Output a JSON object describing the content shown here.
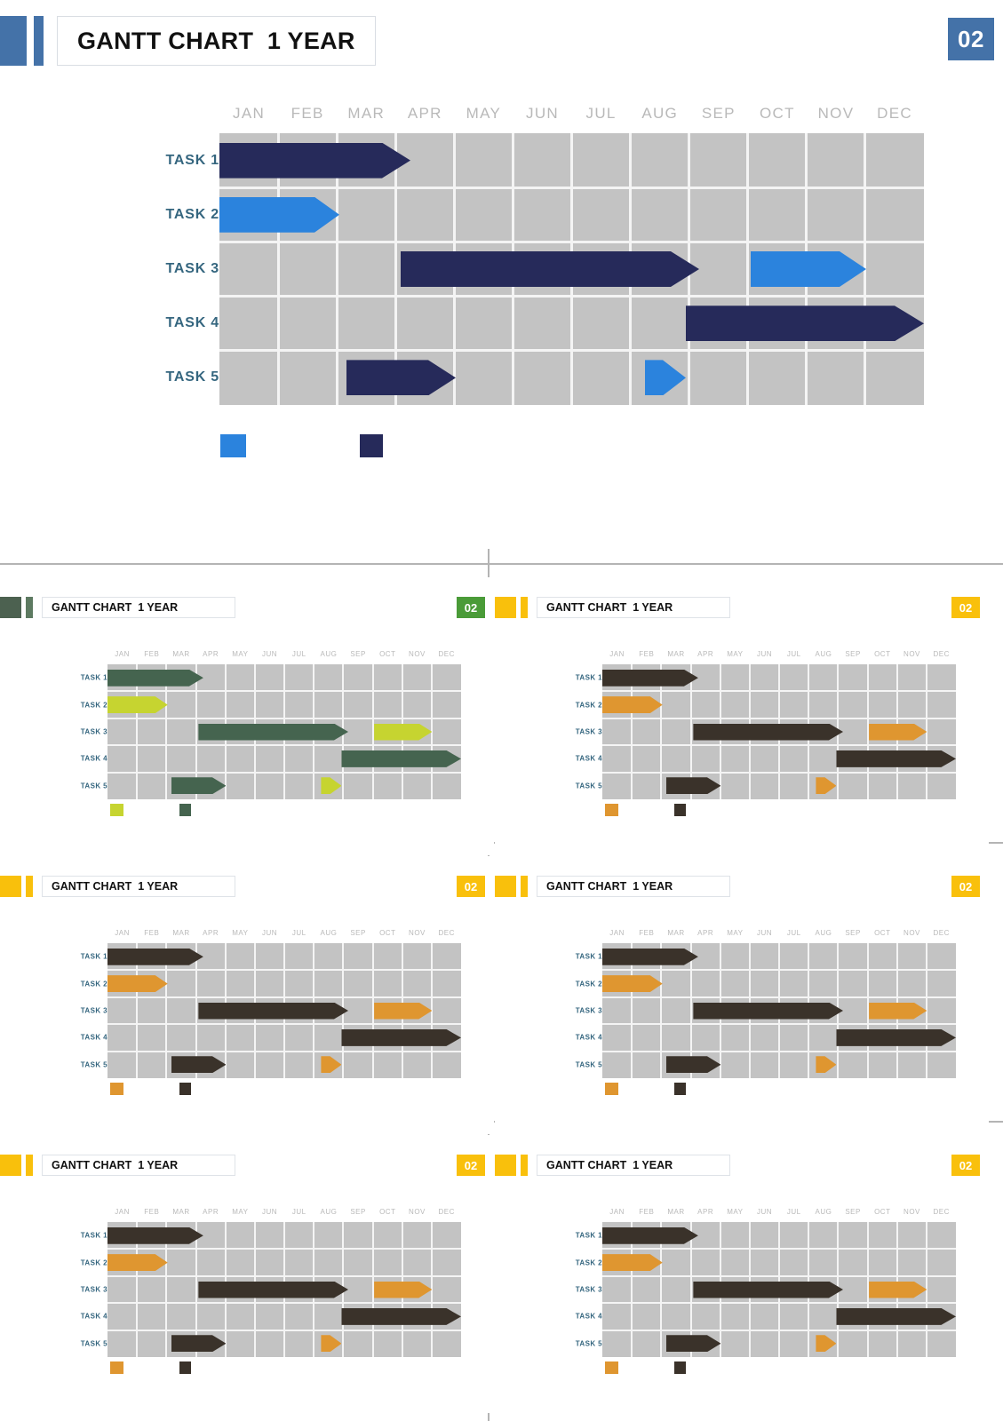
{
  "slide": {
    "title": "GANTT CHART  1 YEAR",
    "page_number": "02",
    "accent_color": "#4472a8",
    "badge_color": "#4472a8",
    "title_color": "#111111"
  },
  "chart_data": {
    "type": "bar",
    "subtype": "gantt",
    "title": "GANTT CHART  1 YEAR",
    "xlabel": "",
    "ylabel": "",
    "grid": true,
    "legend_position": "bottom-left",
    "categories": [
      "JAN",
      "FEB",
      "MAR",
      "APR",
      "MAY",
      "JUN",
      "JUL",
      "AUG",
      "SEP",
      "OCT",
      "NOV",
      "DEC"
    ],
    "x": [
      1,
      2,
      3,
      4,
      5,
      6,
      7,
      8,
      9,
      10,
      11,
      12
    ],
    "xlim": [
      1,
      13
    ],
    "tasks": [
      "TASK 1",
      "TASK 2",
      "TASK 3",
      "TASK 4",
      "TASK 5"
    ],
    "series": [
      {
        "name": "primary",
        "color": "#262a5a",
        "values": [
          {
            "task": "TASK 1",
            "start_month": 1,
            "end_month": 4.1
          },
          {
            "task": "TASK 3",
            "start_month": 4.1,
            "end_month": 9.2
          },
          {
            "task": "TASK 4",
            "start_month": 9.0,
            "end_month": 13.0
          },
          {
            "task": "TASK 5",
            "start_month": 3.2,
            "end_month": 5.1
          }
        ]
      },
      {
        "name": "secondary",
        "color": "#2b83dd",
        "values": [
          {
            "task": "TASK 2",
            "start_month": 1,
            "end_month": 3.05
          },
          {
            "task": "TASK 3",
            "start_month": 10.05,
            "end_month": 12.05
          },
          {
            "task": "TASK 5",
            "start_month": 8.25,
            "end_month": 9.0
          }
        ]
      }
    ],
    "legend": [
      {
        "label": "",
        "color": "#2b83dd"
      },
      {
        "label": "",
        "color": "#262a5a"
      }
    ],
    "grid_background": "#c3c3c3",
    "gridline_color": "#f4f4f4",
    "month_label_color": "#b9b9b9",
    "task_label_color": "#35667f"
  },
  "bars": {
    "main": [
      {
        "row": 0,
        "start": 0,
        "end": 215,
        "tip": 32,
        "series": "primary"
      },
      {
        "row": 1,
        "start": 0,
        "end": 135,
        "tip": 28,
        "series": "secondary"
      },
      {
        "row": 2,
        "start": 204,
        "end": 540,
        "tip": 32,
        "series": "primary"
      },
      {
        "row": 2,
        "start": 598,
        "end": 728,
        "tip": 30,
        "series": "secondary"
      },
      {
        "row": 3,
        "start": 525,
        "end": 793,
        "tip": 33,
        "series": "primary"
      },
      {
        "row": 4,
        "start": 143,
        "end": 266,
        "tip": 31,
        "series": "primary"
      },
      {
        "row": 4,
        "start": 479,
        "end": 525,
        "tip": 26,
        "series": "secondary"
      }
    ]
  },
  "thumbnails": [
    {
      "id": "thumb-green",
      "title": "GANTT CHART  1 YEAR",
      "page_number": "02",
      "accent_wide": "#4c6150",
      "accent_thin": "#5d7a61",
      "badge_color": "#4a9b38",
      "primary_color": "#45644f",
      "secondary_color": "#c6d430"
    },
    {
      "id": "thumb-orange-1",
      "title": "GANTT CHART  1 YEAR",
      "page_number": "02",
      "accent_wide": "#f9c00c",
      "accent_thin": "#f9c00c",
      "badge_color": "#f9c00c",
      "primary_color": "#3a322a",
      "secondary_color": "#df9630"
    },
    {
      "id": "thumb-orange-2",
      "title": "GANTT CHART  1 YEAR",
      "page_number": "02",
      "accent_wide": "#f9c00c",
      "accent_thin": "#f9c00c",
      "badge_color": "#f9c00c",
      "primary_color": "#3a322a",
      "secondary_color": "#df9630"
    },
    {
      "id": "thumb-orange-3",
      "title": "GANTT CHART  1 YEAR",
      "page_number": "02",
      "accent_wide": "#f9c00c",
      "accent_thin": "#f9c00c",
      "badge_color": "#f9c00c",
      "primary_color": "#3a322a",
      "secondary_color": "#df9630"
    },
    {
      "id": "thumb-orange-4",
      "title": "GANTT CHART  1 YEAR",
      "page_number": "02",
      "accent_wide": "#f9c00c",
      "accent_thin": "#f9c00c",
      "badge_color": "#f9c00c",
      "primary_color": "#3a322a",
      "secondary_color": "#df9630"
    },
    {
      "id": "thumb-orange-5",
      "title": "GANTT CHART  1 YEAR",
      "page_number": "02",
      "accent_wide": "#f9c00c",
      "accent_thin": "#f9c00c",
      "badge_color": "#f9c00c",
      "primary_color": "#3a322a",
      "secondary_color": "#df9630"
    }
  ]
}
